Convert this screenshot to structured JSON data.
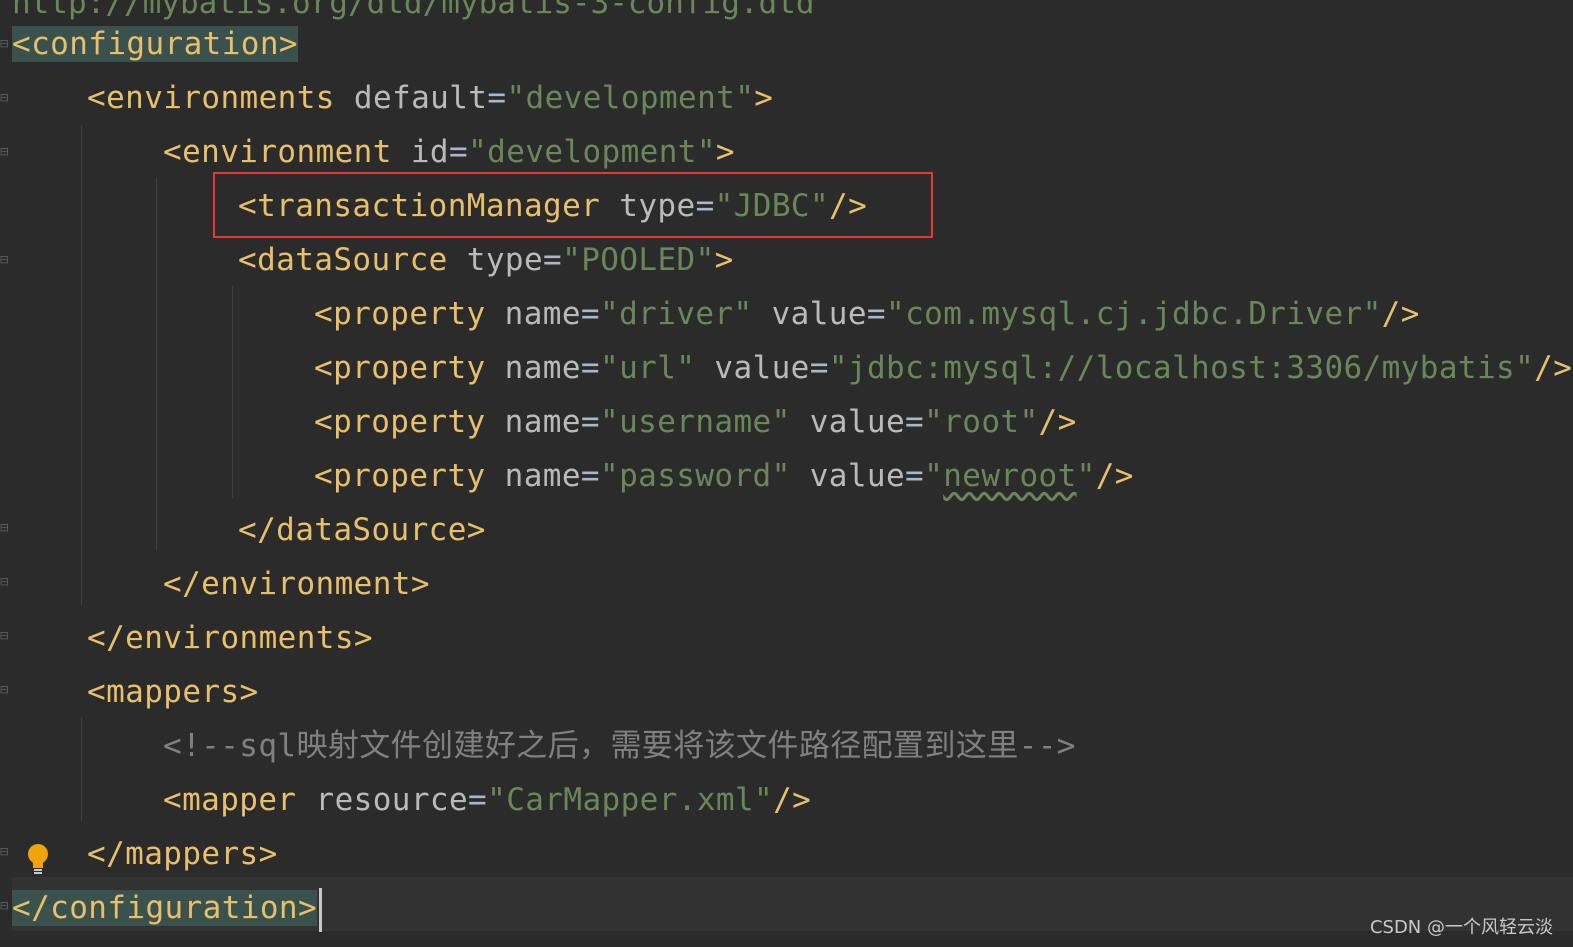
{
  "editor": {
    "top_partial": "http://mybatis.org/dtd/mybatis-3-config.dtd",
    "lines": [
      {
        "tag_open": "<configuration>"
      },
      {
        "tag": "<environments",
        "attr": "default",
        "value": "\"development\"",
        "close": ">"
      },
      {
        "tag": "<environment",
        "attr": "id",
        "value": "\"development\"",
        "close": ">"
      },
      {
        "tag": "<transactionManager",
        "attr": "type",
        "value": "\"JDBC\"",
        "close": "/>"
      },
      {
        "tag": "<dataSource",
        "attr": "type",
        "value": "\"POOLED\"",
        "close": ">"
      },
      {
        "tag": "<property",
        "attr1": "name",
        "val1": "\"driver\"",
        "attr2": "value",
        "val2": "\"com.mysql.cj.jdbc.Driver\"",
        "close": "/>"
      },
      {
        "tag": "<property",
        "attr1": "name",
        "val1": "\"url\"",
        "attr2": "value",
        "val2": "\"jdbc:mysql://localhost:3306/mybatis\"",
        "close": "/>"
      },
      {
        "tag": "<property",
        "attr1": "name",
        "val1": "\"username\"",
        "attr2": "value",
        "val2": "\"root\"",
        "close": "/>"
      },
      {
        "tag": "<property",
        "attr1": "name",
        "val1": "\"password\"",
        "attr2": "value",
        "val2q1": "\"",
        "val2": "newroot",
        "val2q2": "\"",
        "close": "/>"
      },
      {
        "tag": "</dataSource>"
      },
      {
        "tag": "</environment>"
      },
      {
        "tag": "</environments>"
      },
      {
        "tag": "<mappers>"
      },
      {
        "comment_start": "<!--sql",
        "comment_cjk": "映射文件创建好之后，需要将该文件路径配置到这里",
        "comment_end": "-->"
      },
      {
        "tag": "<mapper",
        "attr": "resource",
        "value": "\"CarMapper.xml\"",
        "close": "/>"
      },
      {
        "tag": "</mappers>"
      },
      {
        "tag_close": "</configuration>"
      }
    ]
  },
  "watermark": "CSDN @一个风轻云淡",
  "colors": {
    "background": "#2b2b2b",
    "tag": "#e8bf6a",
    "attribute": "#bababa",
    "string": "#6a8759",
    "comment": "#808080",
    "highlight_box": "#e53935"
  }
}
